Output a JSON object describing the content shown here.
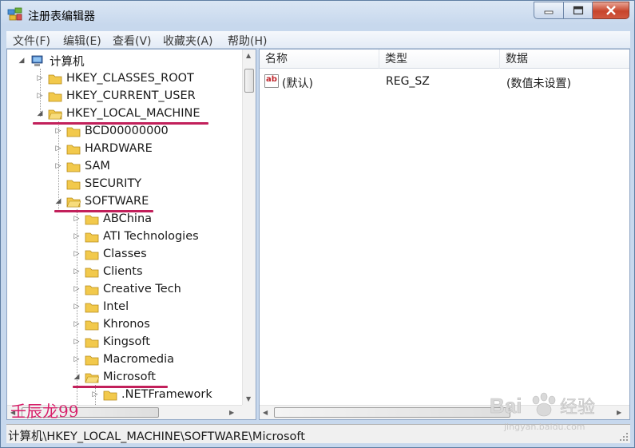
{
  "window": {
    "title": "注册表编辑器"
  },
  "menubar": {
    "items": [
      {
        "label": "文件(F)"
      },
      {
        "label": "编辑(E)"
      },
      {
        "label": "查看(V)"
      },
      {
        "label": "收藏夹(A)"
      },
      {
        "label": "帮助(H)"
      }
    ]
  },
  "tree": {
    "root": "计算机",
    "nodes": [
      {
        "label": "HKEY_CLASSES_ROOT",
        "expanded": false
      },
      {
        "label": "HKEY_CURRENT_USER",
        "expanded": false
      },
      {
        "label": "HKEY_LOCAL_MACHINE",
        "expanded": true,
        "underlined": true
      },
      {
        "label": "BCD00000000",
        "expanded": false
      },
      {
        "label": "HARDWARE",
        "expanded": false
      },
      {
        "label": "SAM",
        "expanded": false
      },
      {
        "label": "SECURITY",
        "expanded": false
      },
      {
        "label": "SOFTWARE",
        "expanded": true,
        "underlined": true
      },
      {
        "label": "ABChina",
        "expanded": false
      },
      {
        "label": "ATI Technologies",
        "expanded": false
      },
      {
        "label": "Classes",
        "expanded": false
      },
      {
        "label": "Clients",
        "expanded": false
      },
      {
        "label": "Creative Tech",
        "expanded": false
      },
      {
        "label": "Intel",
        "expanded": false
      },
      {
        "label": "Khronos",
        "expanded": false
      },
      {
        "label": "Kingsoft",
        "expanded": false
      },
      {
        "label": "Macromedia",
        "expanded": false
      },
      {
        "label": "Microsoft",
        "expanded": true,
        "underlined": true,
        "selected": true
      },
      {
        "label": ".NETFramework",
        "expanded": false
      }
    ]
  },
  "list": {
    "columns": [
      "名称",
      "类型",
      "数据"
    ],
    "rows": [
      {
        "name": "(默认)",
        "type": "REG_SZ",
        "data": "(数值未设置)"
      }
    ]
  },
  "statusbar": {
    "path": "计算机\\HKEY_LOCAL_MACHINE\\SOFTWARE\\Microsoft"
  },
  "watermark": {
    "text": "壬辰龙99"
  },
  "baidu": {
    "logo_text": "Bai 经验",
    "url": "jingyan.baidu.com"
  },
  "colors": {
    "underline": "#c2205b",
    "watermark": "#d81f6a",
    "folder": "#f2c94c"
  }
}
